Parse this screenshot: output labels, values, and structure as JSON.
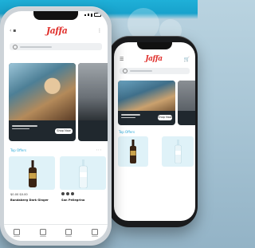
{
  "app": {
    "brand_logo_text": "Jaffa",
    "accent_color": "#2aa9d8",
    "brand_color": "#e0312d"
  },
  "front_phone": {
    "status_time": "",
    "promo_button": "Shop Now",
    "section_title": "Top Offers",
    "products": [
      {
        "price": "$0.00 $0.00",
        "name": "Bundaberg Dark Ginger"
      },
      {
        "price": "$0.00 $0.00",
        "name": "San Pellegrino"
      }
    ]
  },
  "back_phone": {
    "promo_button": "Shop Now",
    "section_title": "Top Offers"
  },
  "icons": {
    "search": "search-icon",
    "cart": "cart-icon",
    "menu": "menu-icon",
    "tabs": [
      "home-icon",
      "categories-icon",
      "orders-icon",
      "account-icon"
    ]
  }
}
